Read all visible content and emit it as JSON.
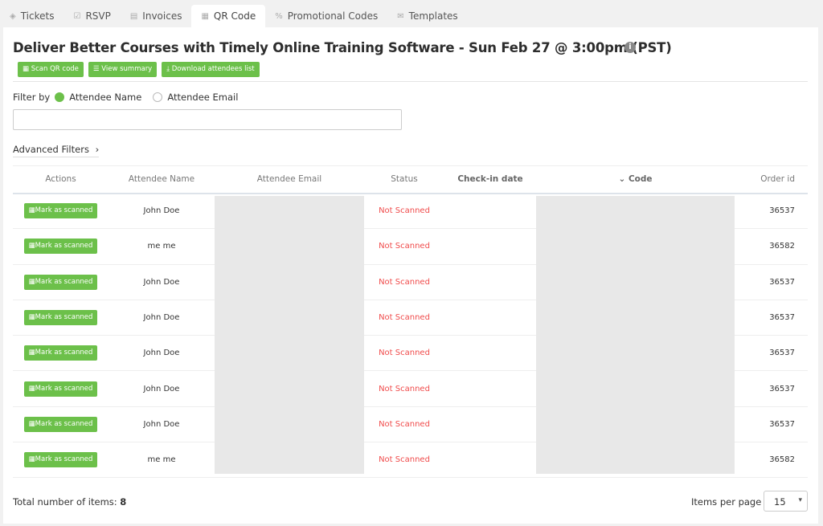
{
  "tabs": [
    {
      "label": "Tickets",
      "icon": "tag-icon"
    },
    {
      "label": "RSVP",
      "icon": "checkbox-icon"
    },
    {
      "label": "Invoices",
      "icon": "document-icon"
    },
    {
      "label": "QR Code",
      "icon": "qr-icon",
      "active": true
    },
    {
      "label": "Promotional Codes",
      "icon": "percent-icon"
    },
    {
      "label": "Templates",
      "icon": "envelope-icon"
    }
  ],
  "title": "Deliver Better Courses with Timely Online Training Software - Sun Feb 27 @ 3:00pm (PST)",
  "buttons": {
    "scan": "Scan QR code",
    "summary": "View summary",
    "download": "Download attendees list"
  },
  "filter": {
    "label": "Filter by",
    "opt1": "Attendee Name",
    "opt2": "Attendee Email",
    "selected": "Attendee Name",
    "search_value": ""
  },
  "advanced": "Advanced Filters",
  "columns": [
    "Actions",
    "Attendee Name",
    "Attendee Email",
    "Status",
    "Check-in date",
    "Code",
    "Order id"
  ],
  "action_label": "Mark as scanned",
  "rows": [
    {
      "name": "John Doe",
      "status": "Not Scanned",
      "order": "36537"
    },
    {
      "name": "me me",
      "status": "Not Scanned",
      "order": "36582"
    },
    {
      "name": "John Doe",
      "status": "Not Scanned",
      "order": "36537"
    },
    {
      "name": "John Doe",
      "status": "Not Scanned",
      "order": "36537"
    },
    {
      "name": "John Doe",
      "status": "Not Scanned",
      "order": "36537"
    },
    {
      "name": "John Doe",
      "status": "Not Scanned",
      "order": "36537"
    },
    {
      "name": "John Doe",
      "status": "Not Scanned",
      "order": "36537"
    },
    {
      "name": "me me",
      "status": "Not Scanned",
      "order": "36582"
    }
  ],
  "footer": {
    "total_label": "Total number of items:",
    "total": "8",
    "per_page_label": "Items per page",
    "per_page": "15"
  },
  "colors": {
    "accent": "#6cc04a",
    "status": "#f04b4b"
  }
}
